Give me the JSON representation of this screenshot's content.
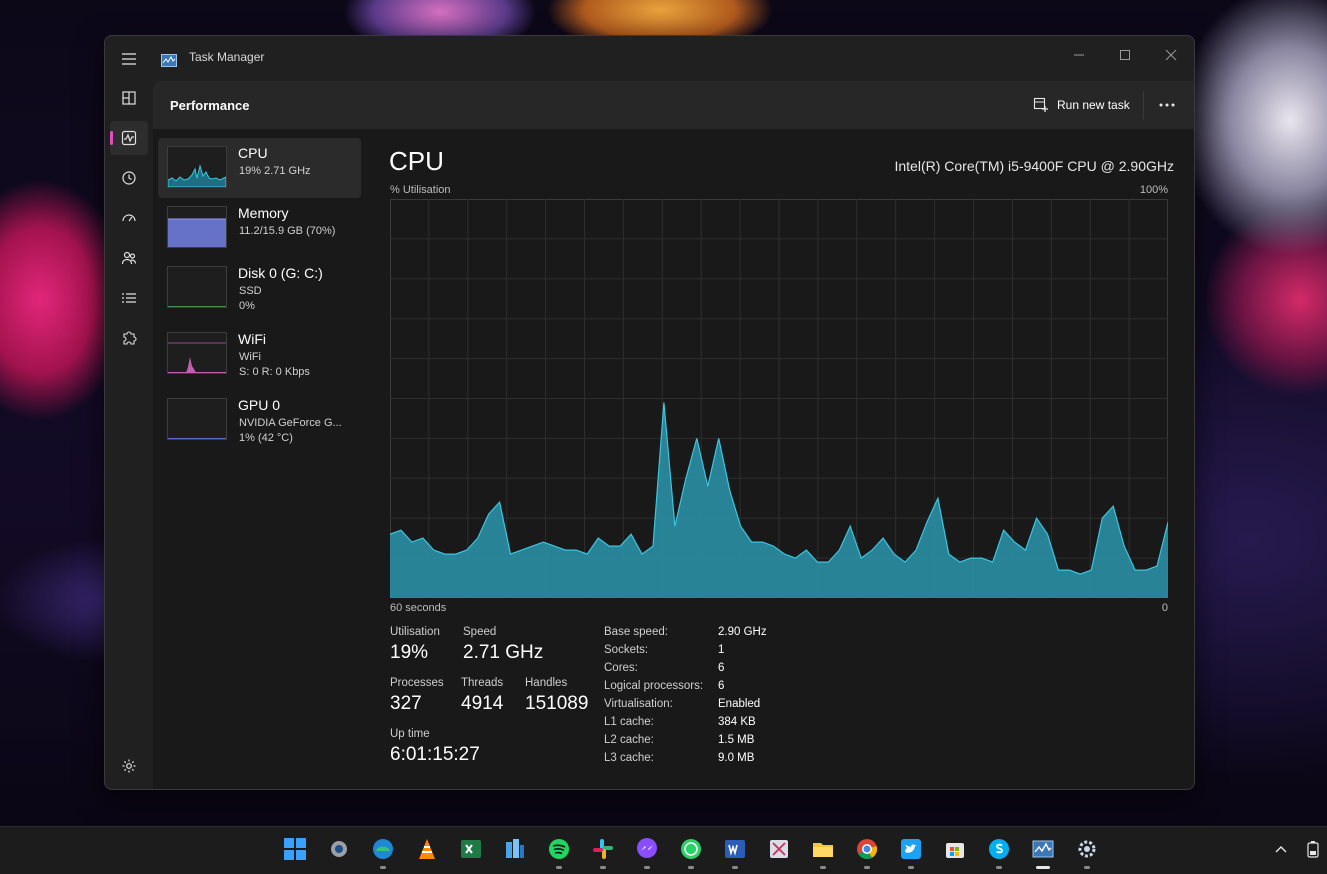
{
  "window": {
    "title": "Task Manager"
  },
  "header": {
    "page_title": "Performance",
    "run_task_label": "Run new task"
  },
  "devices": [
    {
      "name": "CPU",
      "line1": "19%  2.71 GHz",
      "line2": ""
    },
    {
      "name": "Memory",
      "line1": "11.2/15.9 GB (70%)",
      "line2": ""
    },
    {
      "name": "Disk 0 (G: C:)",
      "line1": "SSD",
      "line2": "0%"
    },
    {
      "name": "WiFi",
      "line1": "WiFi",
      "line2": "S: 0  R: 0 Kbps"
    },
    {
      "name": "GPU 0",
      "line1": "NVIDIA GeForce G...",
      "line2": "1%  (42 °C)"
    }
  ],
  "cpu": {
    "heading": "CPU",
    "model": "Intel(R) Core(TM) i5-9400F CPU @ 2.90GHz",
    "axis": {
      "y_label": "% Utilisation",
      "y_max_label": "100%",
      "x_left_label": "60 seconds",
      "x_right_label": "0"
    },
    "stats": {
      "utilisation_label": "Utilisation",
      "utilisation_value": "19%",
      "speed_label": "Speed",
      "speed_value": "2.71 GHz",
      "processes_label": "Processes",
      "processes_value": "327",
      "threads_label": "Threads",
      "threads_value": "4914",
      "handles_label": "Handles",
      "handles_value": "151089",
      "uptime_label": "Up time",
      "uptime_value": "6:01:15:27"
    },
    "details": [
      {
        "label": "Base speed:",
        "value": "2.90 GHz"
      },
      {
        "label": "Sockets:",
        "value": "1"
      },
      {
        "label": "Cores:",
        "value": "6"
      },
      {
        "label": "Logical processors:",
        "value": "6"
      },
      {
        "label": "Virtualisation:",
        "value": "Enabled"
      },
      {
        "label": "L1 cache:",
        "value": "384 KB"
      },
      {
        "label": "L2 cache:",
        "value": "1.5 MB"
      },
      {
        "label": "L3 cache:",
        "value": "9.0 MB"
      }
    ],
    "usage_history_percent": [
      16,
      17,
      14,
      15,
      12,
      11,
      11,
      12,
      15,
      21,
      24,
      11,
      12,
      13,
      14,
      13,
      12,
      12,
      11,
      15,
      13,
      13,
      16,
      11,
      13,
      49,
      18,
      30,
      40,
      28,
      40,
      27,
      18,
      14,
      14,
      13,
      11,
      10,
      12,
      9,
      9,
      12,
      18,
      10,
      12,
      15,
      11,
      9,
      12,
      19,
      25,
      11,
      9,
      10,
      10,
      9,
      17,
      14,
      12,
      20,
      16,
      7,
      7,
      6,
      7,
      20,
      23,
      13,
      7,
      7,
      8,
      19
    ],
    "colors": {
      "graph_fill": "#2a8fa5",
      "graph_line": "#3cc6e0",
      "grid": "#2e2e2e"
    }
  },
  "taskbar": {
    "apps": [
      "windows-start-icon",
      "settings-gear-icon",
      "edge-icon",
      "vlc-icon",
      "excel-icon",
      "azure-data-studio-icon",
      "spotify-icon",
      "slack-icon",
      "messenger-icon",
      "whatsapp-icon",
      "word-icon",
      "snipping-tool-icon",
      "file-explorer-icon",
      "chrome-icon",
      "twitter-icon",
      "microsoft-store-icon",
      "skype-icon",
      "task-manager-icon",
      "settings-cog-icon"
    ]
  },
  "colors": {
    "accent": "#e74cbe",
    "window_bg": "#202020",
    "content_bg": "#191919"
  }
}
